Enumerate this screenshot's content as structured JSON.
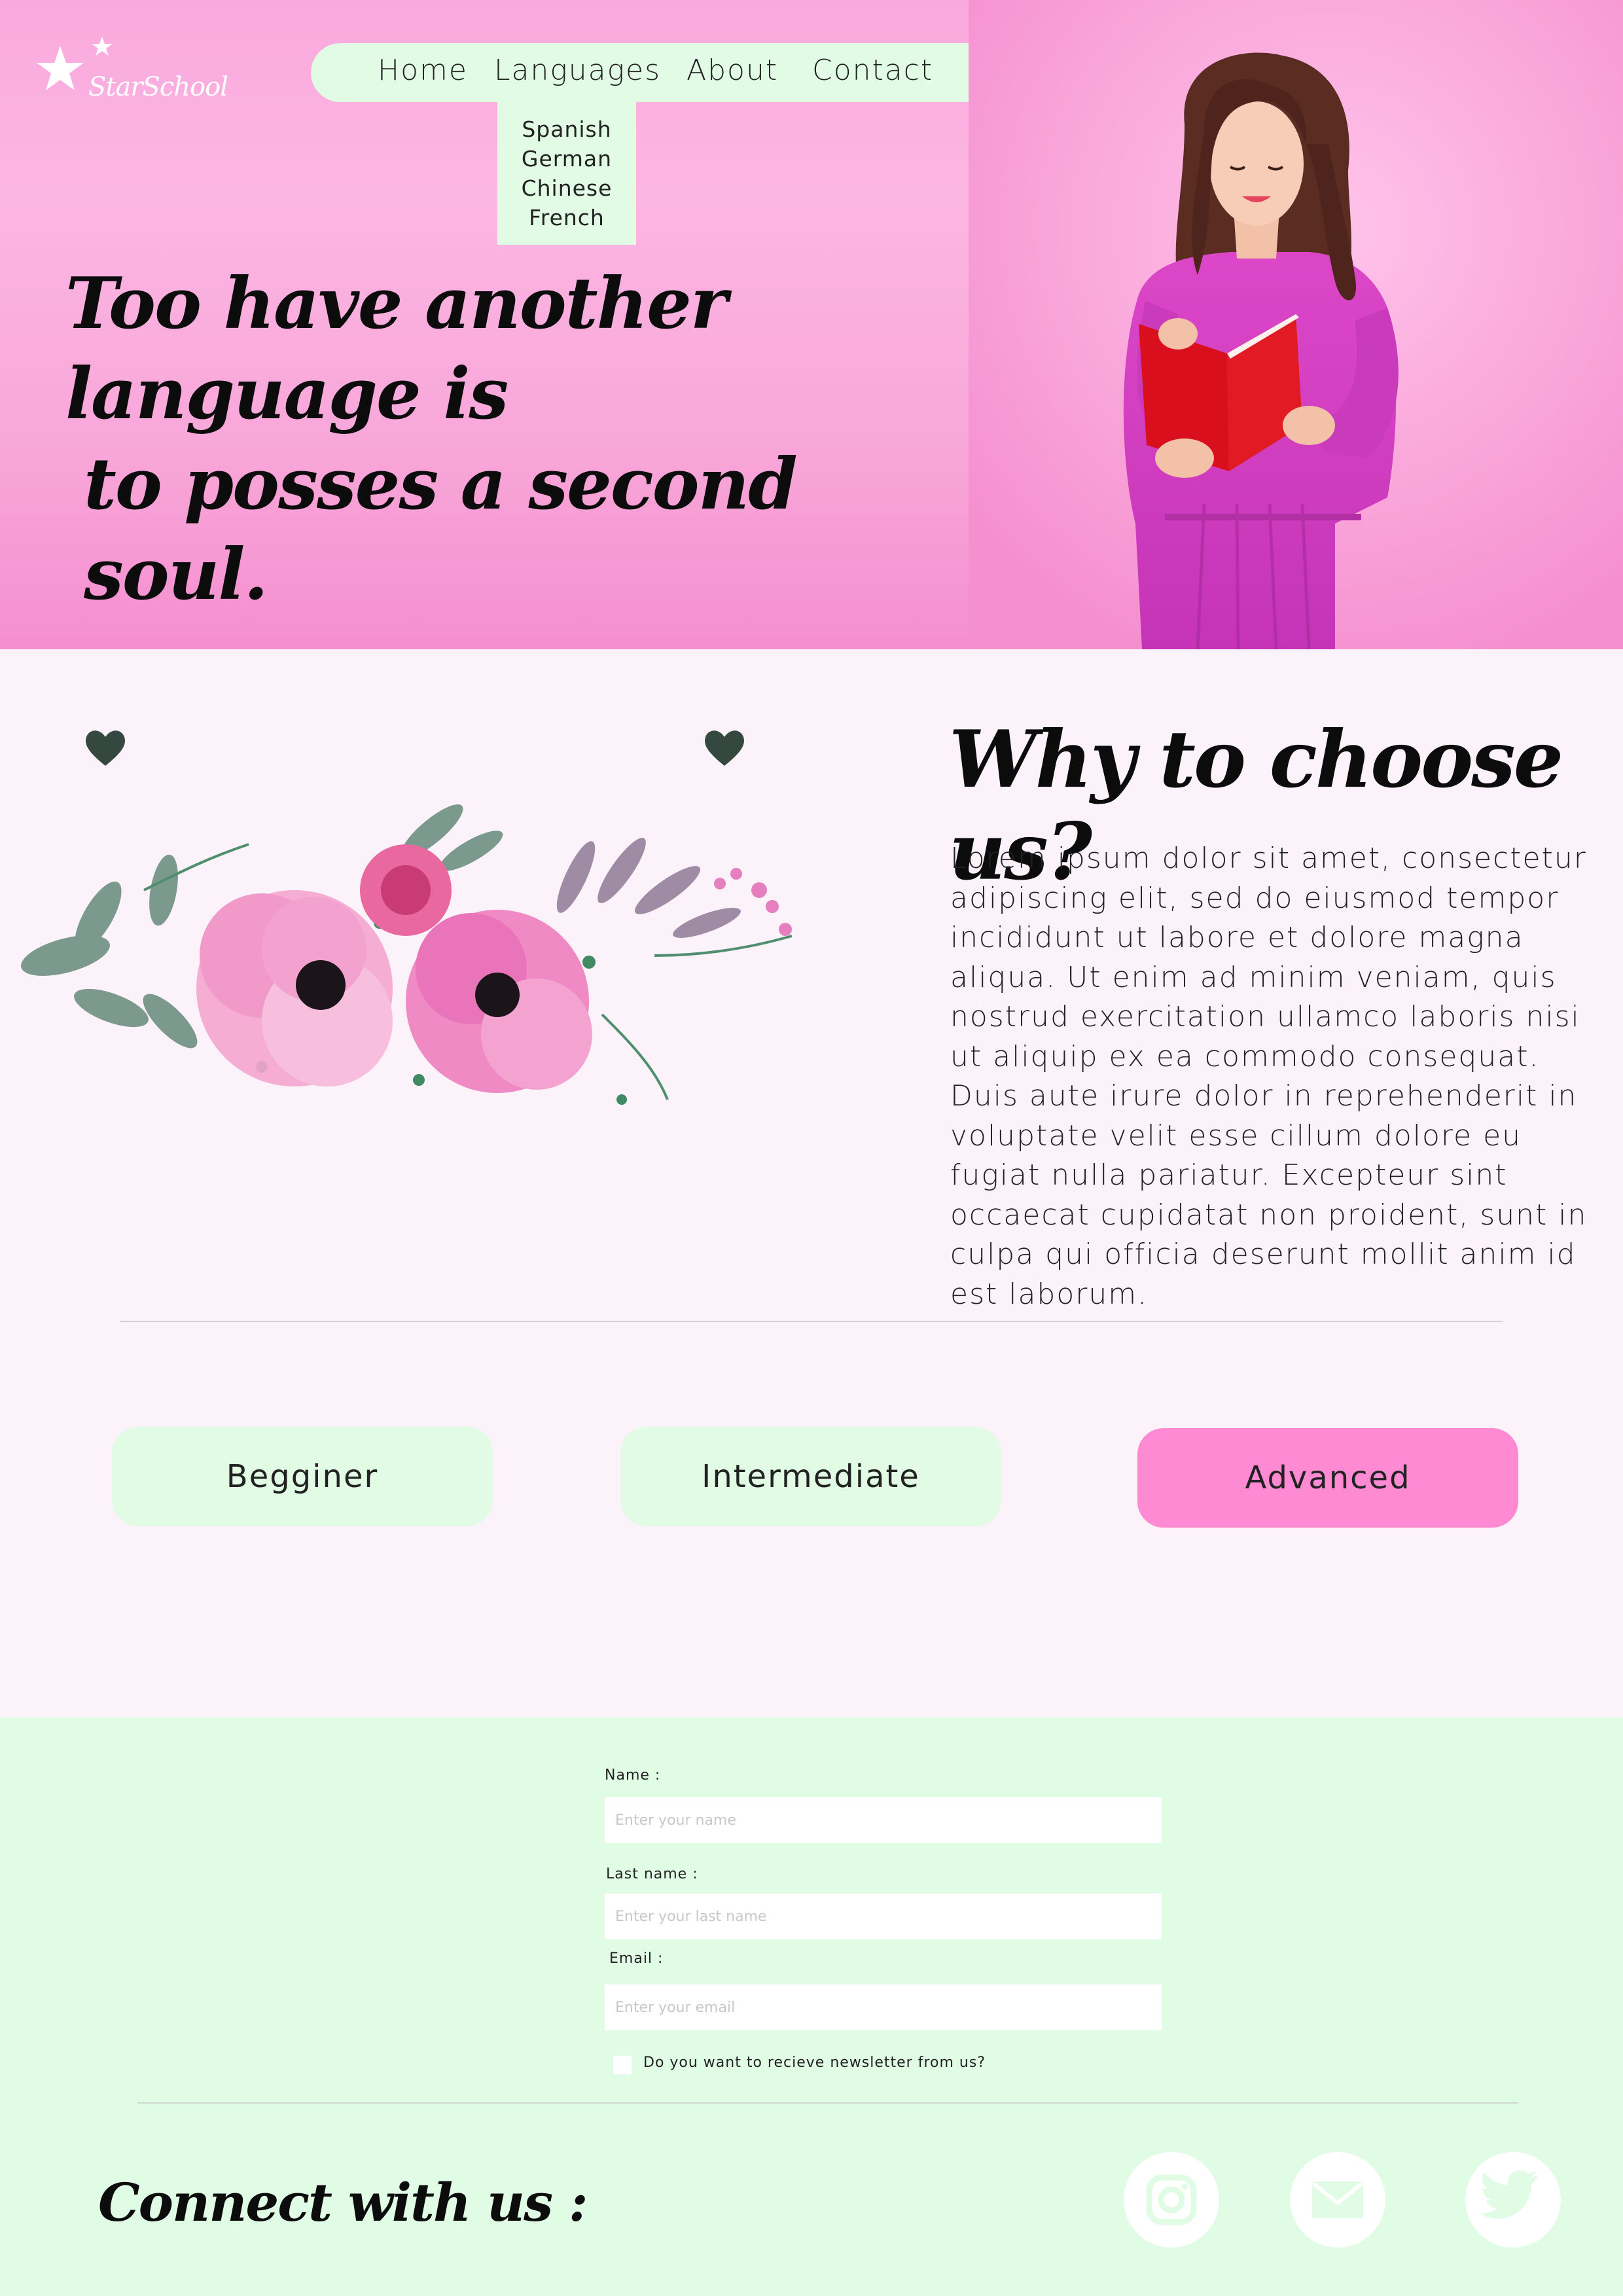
{
  "brand": {
    "name": "StarSchool"
  },
  "nav": {
    "items": [
      "Home",
      "Languages",
      "About",
      "Contact"
    ],
    "languages_dropdown": [
      "Spanish",
      "German",
      "Chinese",
      "French"
    ]
  },
  "hero": {
    "quote_line1": "Too have another language is",
    "quote_line2": "to posses a second soul."
  },
  "why": {
    "title": "Why to choose us?",
    "body": "Lorem ipsum dolor sit amet, consectetur adipiscing elit, sed do eiusmod tempor incididunt ut labore et dolore magna aliqua. Ut enim ad minim veniam, quis nostrud exercitation ullamco laboris nisi ut aliquip ex ea commodo consequat. Duis aute irure dolor in reprehenderit in voluptate velit esse cillum dolore eu fugiat nulla pariatur. Excepteur sint occaecat cupidatat non proident, sunt in culpa qui officia deserunt mollit anim id est laborum."
  },
  "levels": {
    "items": [
      "Begginer",
      "Intermediate",
      "Advanced"
    ],
    "selected": "Advanced"
  },
  "form": {
    "name_label": "Name :",
    "name_placeholder": "Enter your name",
    "lastname_label": "Last name :",
    "lastname_placeholder": "Enter your last name",
    "email_label": "Email :",
    "email_placeholder": "Enter your email",
    "newsletter_label": "Do you want to recieve newsletter from us?"
  },
  "footer": {
    "connect_title": "Connect with us :",
    "social_icons": [
      "instagram-icon",
      "mail-icon",
      "twitter-icon"
    ]
  },
  "colors": {
    "hero_pink": "#f9a9dd",
    "mint": "#e1fbe5",
    "accent_pink": "#fe8ad4",
    "page_bg": "#fbf3f9"
  }
}
